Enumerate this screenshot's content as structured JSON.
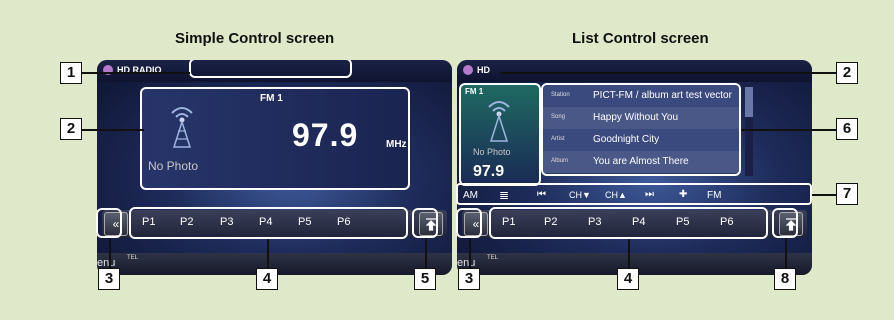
{
  "titles": {
    "simple": "Simple Control screen",
    "list": "List Control screen"
  },
  "callouts": [
    "1",
    "2",
    "3",
    "4",
    "5",
    "2",
    "6",
    "7",
    "3",
    "4",
    "8"
  ],
  "simple": {
    "source_label": "HD RADIO",
    "band": "FM 1",
    "frequency": "97.9",
    "unit": "MHz",
    "no_photo": "No Photo",
    "presets": [
      "P1",
      "P2",
      "P3",
      "P4",
      "P5",
      "P6"
    ],
    "menu": "enu",
    "tel": "TEL"
  },
  "list": {
    "source_label": "HD",
    "band": "FM 1",
    "frequency": "97.9",
    "no_photo": "No Photo",
    "rows": [
      {
        "label": "Station",
        "value": "PICT-FM / album art test vector"
      },
      {
        "label": "Song",
        "value": "Happy Without You"
      },
      {
        "label": "Artist",
        "value": "Goodnight City"
      },
      {
        "label": "Album",
        "value": "You are Almost There"
      }
    ],
    "controls": [
      "AM",
      "≣",
      "⏮",
      "CH▼",
      "CH▲",
      "⏭",
      "✚",
      "FM"
    ],
    "presets": [
      "P1",
      "P2",
      "P3",
      "P4",
      "P5",
      "P6"
    ],
    "menu": "enu",
    "tel": "TEL"
  }
}
